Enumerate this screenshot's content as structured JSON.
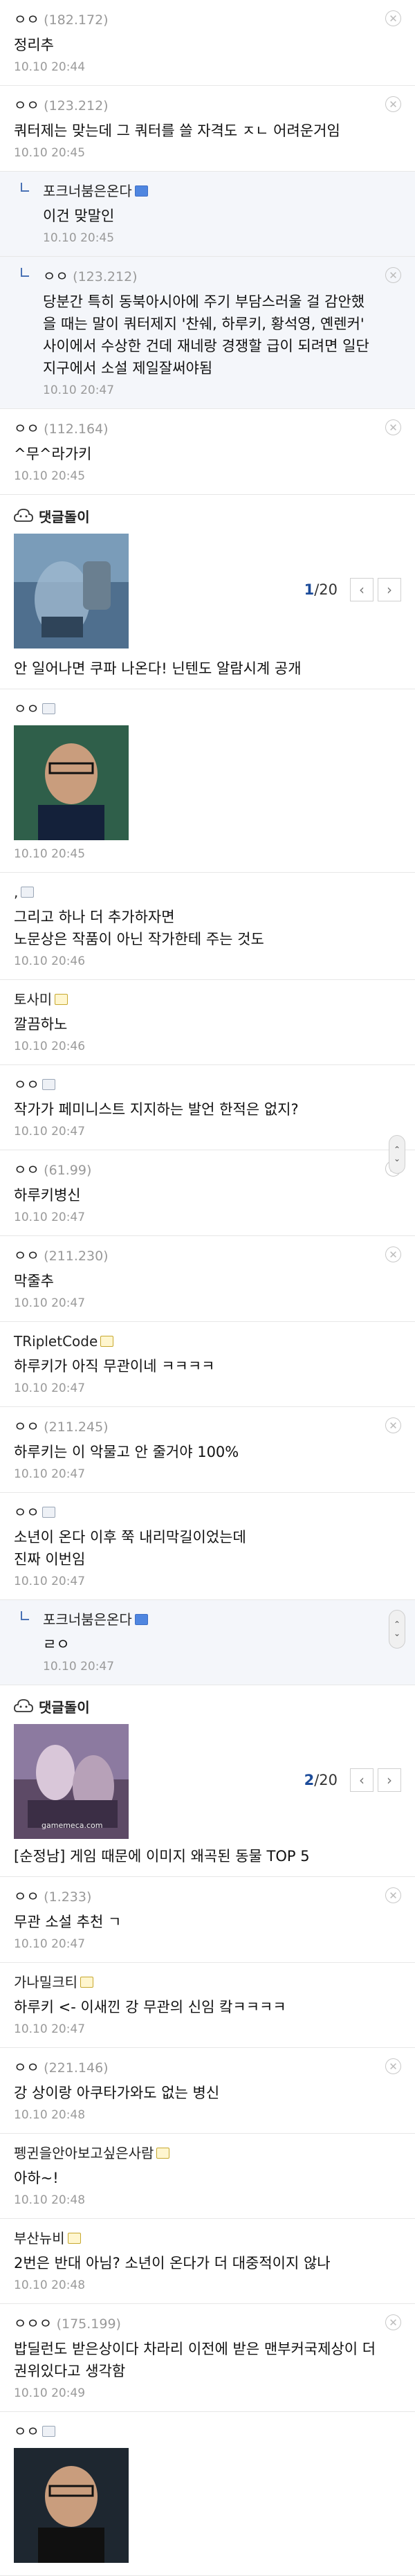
{
  "comments_a": [
    {
      "user": "ㅇㅇ",
      "ip": "(182.172)",
      "body": [
        "정리추"
      ],
      "time": "10.10 20:44",
      "deletable": true
    },
    {
      "user": "ㅇㅇ",
      "ip": "(123.212)",
      "body": [
        "쿼터제는 맞는데 그 쿼터를 쓸 자격도 ㅈㄴ 어려운거임"
      ],
      "time": "10.10 20:45",
      "deletable": true
    },
    {
      "user": "포크너붐은온다",
      "badge": "b",
      "reply": true,
      "body": [
        "이건 맞말인"
      ],
      "time": "10.10 20:45"
    },
    {
      "user": "ㅇㅇ",
      "ip": "(123.212)",
      "reply": true,
      "deletable": true,
      "body": [
        "당분간 특히 동북아시아에 주기 부담스러울 걸 감안했을 때는 말이 쿼터제지 '찬쉐, 하루키, 황석영, 옌렌커' 사이에서 수상한 건데 재네랑 경쟁할 급이 되려면 일단 지구에서 소설 제일잘써야됨"
      ],
      "time": "10.10 20:47"
    },
    {
      "user": "ㅇㅇ",
      "ip": "(112.164)",
      "body": [
        "^무^라가키"
      ],
      "time": "10.10 20:45",
      "deletable": true
    }
  ],
  "ad1": {
    "title": "댓글돌이",
    "count_current": "1",
    "count_total": "/20",
    "caption": "안 일어나면 쿠파 나온다! 닌텐도 알람시계 공개"
  },
  "comments_b": [
    {
      "user": "ㅇㅇ",
      "badge": "g",
      "image": true,
      "time": "10.10 20:45"
    },
    {
      "user": ",",
      "badge": "g",
      "body": [
        "그리고 하나 더 추가하자면",
        "노문상은 작품이 아닌 작가한테 주는 것도"
      ],
      "time": "10.10 20:46"
    },
    {
      "user": "토사미",
      "badge": "y",
      "body": [
        "깔끔하노"
      ],
      "time": "10.10 20:46"
    },
    {
      "user": "ㅇㅇ",
      "badge": "g",
      "body": [
        "작가가 페미니스트 지지하는 발언 한적은 없지?"
      ],
      "time": "10.10 20:47"
    },
    {
      "user": "ㅇㅇ",
      "ip": "(61.99)",
      "body": [
        "하루키병신"
      ],
      "time": "10.10 20:47",
      "deletable": true
    },
    {
      "user": "ㅇㅇ",
      "ip": "(211.230)",
      "body": [
        "막줄추"
      ],
      "time": "10.10 20:47",
      "deletable": true
    },
    {
      "user": "TRipletCode",
      "badge": "y",
      "body": [
        "하루키가 아직 무관이네 ㅋㅋㅋㅋ"
      ],
      "time": "10.10 20:47"
    },
    {
      "user": "ㅇㅇ",
      "ip": "(211.245)",
      "body": [
        "하루키는 이 악물고 안 줄거야 100%"
      ],
      "time": "10.10 20:47",
      "deletable": true
    },
    {
      "user": "ㅇㅇ",
      "badge": "g",
      "body": [
        "소년이 온다 이후 쭉 내리막길이었는데",
        "진짜 이번임"
      ],
      "time": "10.10 20:47"
    },
    {
      "user": "포크너붐은온다",
      "badge": "b",
      "reply": true,
      "body": [
        "ㄹㅇ"
      ],
      "time": "10.10 20:47"
    }
  ],
  "ad2": {
    "title": "댓글돌이",
    "count_current": "2",
    "count_total": "/20",
    "caption": "[순정남] 게임 때문에 이미지 왜곡된 동물 TOP 5",
    "watermark": "gamemeca.com"
  },
  "comments_c": [
    {
      "user": "ㅇㅇ",
      "ip": "(1.233)",
      "body": [
        "무관 소설 추천 ㄱ"
      ],
      "time": "10.10 20:47",
      "deletable": true
    },
    {
      "user": "가나밀크티",
      "badge": "y",
      "body": [
        "하루키 <- 이새낀 강 무관의 신임 캌ㅋㅋㅋㅋ"
      ],
      "time": "10.10 20:47"
    },
    {
      "user": "ㅇㅇ",
      "ip": "(221.146)",
      "body": [
        "강 상이랑 아쿠타가와도 없는 병신"
      ],
      "time": "10.10 20:48",
      "deletable": true
    },
    {
      "user": "펭귄을안아보고싶은사람",
      "badge": "y",
      "body": [
        "아하~!"
      ],
      "time": "10.10 20:48"
    },
    {
      "user": "부산뉴비",
      "badge": "y",
      "body": [
        "2번은 반대 아님? 소년이 온다가 더 대중적이지 않나"
      ],
      "time": "10.10 20:48"
    },
    {
      "user": "ㅇㅇㅇ",
      "ip": "(175.199)",
      "body": [
        "밥딜런도 받은상이다 차라리 이전에 받은 맨부커국제상이 더 권위있다고 생각함"
      ],
      "time": "10.10 20:49",
      "deletable": true
    },
    {
      "user": "ㅇㅇ",
      "badge": "g",
      "image": true,
      "time": ""
    }
  ],
  "icons": {
    "delete": "close-circle-icon",
    "prev": "chevron-left-icon",
    "next": "chevron-right-icon",
    "scroll": "scroll-handle-icon",
    "ad": "cloud-face-icon",
    "reply": "reply-arrow-icon"
  },
  "colors": {
    "accent": "#1d4c9a",
    "reply_bg": "#f4f6fa",
    "divider": "#e7e7e7",
    "meta": "#9a9a9a"
  }
}
